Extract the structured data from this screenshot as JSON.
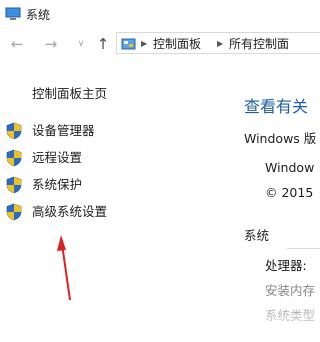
{
  "window": {
    "title": "系统"
  },
  "nav": {
    "back_icon": "arrow-left-icon",
    "forward_icon": "arrow-right-icon",
    "recent_icon": "chevron-down-icon",
    "up_icon": "arrow-up-icon",
    "address": {
      "crumbs": [
        "控制面板",
        "所有控制面"
      ]
    }
  },
  "left_pane": {
    "title": "控制面板主页",
    "tasks": [
      {
        "label": "设备管理器",
        "icon": "shield-icon"
      },
      {
        "label": "远程设置",
        "icon": "shield-icon"
      },
      {
        "label": "系统保护",
        "icon": "shield-icon"
      },
      {
        "label": "高级系统设置",
        "icon": "shield-icon"
      }
    ]
  },
  "right_pane": {
    "heading": "查看有关",
    "edition_label": "Windows 版",
    "edition_value": "Window",
    "copyright": "© 2015",
    "system_label": "系统",
    "processor_label": "处理器:",
    "ram_label": "安装内存",
    "system_type_label": "系统类型"
  },
  "colors": {
    "link": "#1f5fa8",
    "annotation_arrow": "#e02020",
    "shield_blue": "#2a6cc4",
    "shield_yellow": "#f1c21b"
  }
}
